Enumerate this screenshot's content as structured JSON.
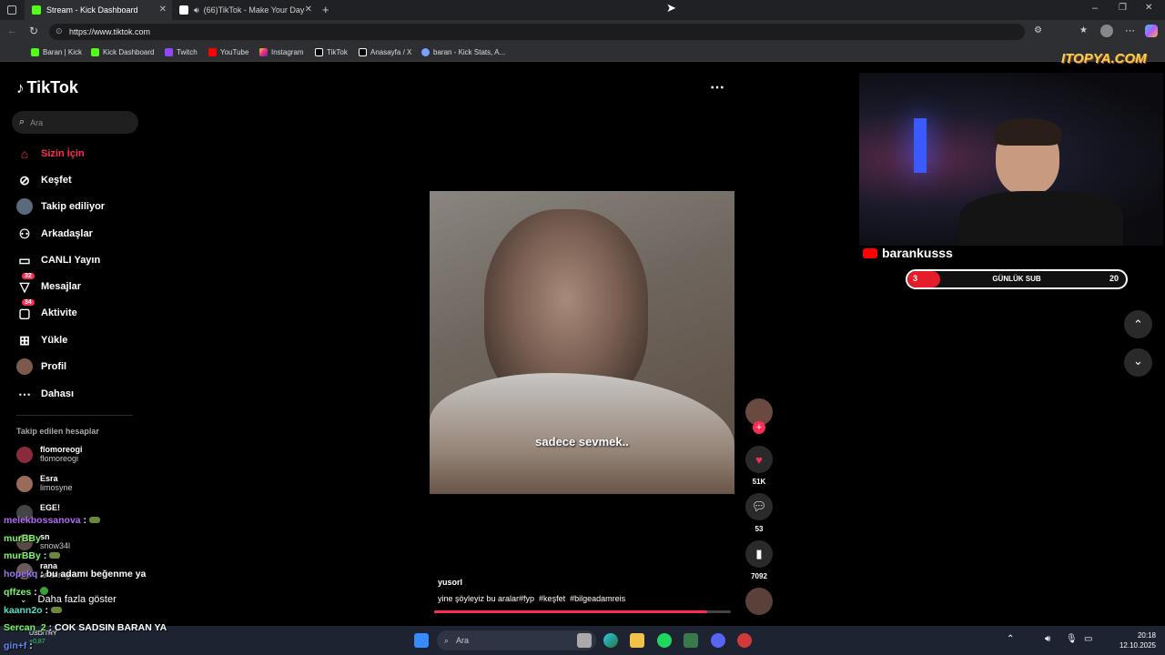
{
  "browser": {
    "tabs": [
      {
        "title": "Stream - Kick Dashboard",
        "active": true
      },
      {
        "title": "(66)TikTok - Make Your Day",
        "active": false
      }
    ],
    "url": "https://www.tiktok.com",
    "bookmarks": [
      "Baran | Kick",
      "Kick Dashboard",
      "Twitch",
      "YouTube",
      "Instagram",
      "TikTok",
      "Anasayfa / X",
      "baran - Kick Stats, A..."
    ]
  },
  "tiktok": {
    "logo": "TikTok",
    "search_placeholder": "Ara",
    "nav": [
      {
        "label": "Sizin İçin",
        "icon": "home-icon",
        "active": true
      },
      {
        "label": "Keşfet",
        "icon": "compass-icon"
      },
      {
        "label": "Takip ediliyor",
        "icon": "following-avatar-icon"
      },
      {
        "label": "Arkadaşlar",
        "icon": "friends-icon"
      },
      {
        "label": "CANLI Yayın",
        "icon": "live-icon"
      },
      {
        "label": "Mesajlar",
        "icon": "messages-icon",
        "badge": "32"
      },
      {
        "label": "Aktivite",
        "icon": "activity-icon",
        "badge": "34"
      },
      {
        "label": "Yükle",
        "icon": "upload-icon"
      },
      {
        "label": "Profil",
        "icon": "profile-avatar-icon"
      },
      {
        "label": "Dahası",
        "icon": "more-icon"
      }
    ],
    "following_header": "Takip edilen hesaplar",
    "following": [
      {
        "name": "flomoreogi",
        "handle": "flomoreogi"
      },
      {
        "name": "Esra",
        "handle": "limosyne"
      },
      {
        "name": "EGE!",
        "handle": ""
      },
      {
        "name": "sn",
        "handle": "snow34l"
      },
      {
        "name": "rana",
        "handle": "anaarag..."
      }
    ],
    "show_more": "Daha fazla göster",
    "video": {
      "subtitle": "sadece sevmek..",
      "author": "yusorl",
      "caption": "yine şöyleyiz bu aralar#fyp  #keşfet  #bilgeadamreis",
      "likes": "51K",
      "comments": "53",
      "saves": "7092"
    }
  },
  "stream_overlay": {
    "site_watermark": "ITOPYA.COM",
    "channel": "barankusss",
    "sub_goal_label": "GÜNLÜK SUB",
    "sub_goal_current": "3",
    "sub_goal_target": "20",
    "sub_goal_fraction": 0.15,
    "chat": [
      {
        "user": "melekbossanova",
        "msg": "",
        "color": "#b06af5"
      },
      {
        "user": "murBBy",
        "msg": "",
        "color": "#7cf56a"
      },
      {
        "user": "murBBy",
        "msg": "",
        "color": "#7cf56a"
      },
      {
        "user": "hopekq",
        "msg": "bu adamı beğenme ya",
        "color": "#9a7af5"
      },
      {
        "user": "qffzes",
        "msg": "",
        "color": "#7cf56a"
      },
      {
        "user": "kaann2o",
        "msg": "",
        "color": "#4fe1c8"
      },
      {
        "user": "Sercan_2",
        "msg": "COK SADSIN BARAN YA",
        "color": "#7cf56a"
      },
      {
        "user": "gin+f",
        "msg": "",
        "color": "#5f8af5"
      }
    ]
  },
  "taskbar": {
    "search_placeholder": "Ara",
    "ticker_label": "USD/TRY",
    "ticker_value": "+0,87",
    "time": "20:18",
    "date": "12.10.2025"
  }
}
